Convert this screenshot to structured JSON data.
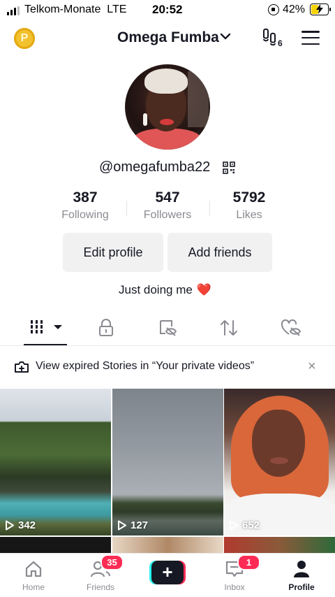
{
  "status_bar": {
    "carrier": "Telkom-Monate",
    "network": "LTE",
    "time": "20:52",
    "battery_percent": "42%",
    "battery_level": 0.42
  },
  "header": {
    "name": "Omega Fumba",
    "footprint_count": "6"
  },
  "profile": {
    "username": "@omegafumba22",
    "bio": "Just doing me",
    "bio_emoji": "❤️"
  },
  "stats": [
    {
      "value": "387",
      "label": "Following"
    },
    {
      "value": "547",
      "label": "Followers"
    },
    {
      "value": "5792",
      "label": "Likes"
    }
  ],
  "buttons": {
    "edit_profile": "Edit profile",
    "add_friends": "Add friends"
  },
  "tabs": [
    {
      "icon": "videos-grid-icon",
      "active": true
    },
    {
      "icon": "private-lock-icon",
      "active": false
    },
    {
      "icon": "hidden-eye-icon",
      "active": false
    },
    {
      "icon": "repost-icon",
      "active": false
    },
    {
      "icon": "liked-hidden-icon",
      "active": false
    }
  ],
  "notice": {
    "text": "View expired Stories in “Your private videos”"
  },
  "videos": [
    {
      "views": "342"
    },
    {
      "views": "127"
    },
    {
      "views": "652"
    }
  ],
  "nav": {
    "home": "Home",
    "friends": "Friends",
    "friends_badge": "35",
    "inbox": "Inbox",
    "inbox_badge": "1",
    "profile": "Profile"
  },
  "colors": {
    "accent": "#fe2c55",
    "cyan": "#25f4ee",
    "text": "#161823",
    "muted": "#8a8b91",
    "button_bg": "#f1f1f2"
  }
}
